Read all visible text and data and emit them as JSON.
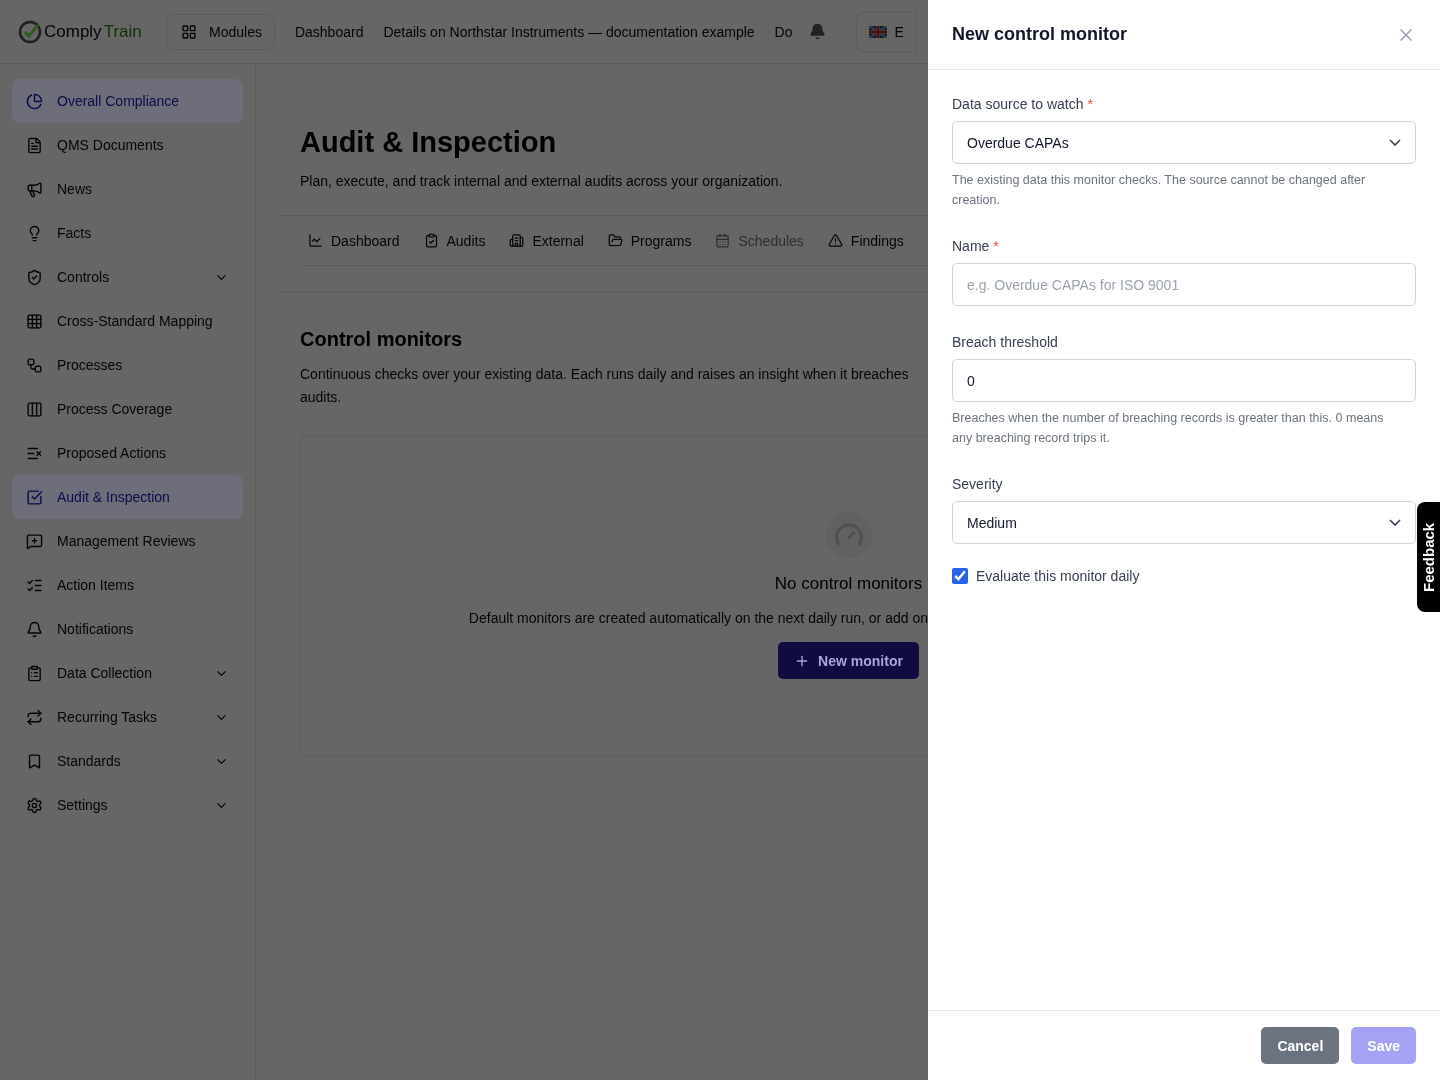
{
  "topbar": {
    "logo": {
      "part1": "Comply",
      "part2": "Train"
    },
    "modules_button": "Modules",
    "nav": [
      "Dashboard",
      "Details on Northstar Instruments — documentation example",
      "Do"
    ],
    "language": "E"
  },
  "sidebar": {
    "items": [
      {
        "label": "Overall Compliance",
        "selected": true,
        "expandable": false
      },
      {
        "label": "QMS Documents",
        "selected": false,
        "expandable": false
      },
      {
        "label": "News",
        "selected": false,
        "expandable": false
      },
      {
        "label": "Facts",
        "selected": false,
        "expandable": false
      },
      {
        "label": "Controls",
        "selected": false,
        "expandable": true
      },
      {
        "label": "Cross-Standard Mapping",
        "selected": false,
        "expandable": false
      },
      {
        "label": "Processes",
        "selected": false,
        "expandable": false
      },
      {
        "label": "Process Coverage",
        "selected": false,
        "expandable": false
      },
      {
        "label": "Proposed Actions",
        "selected": false,
        "expandable": false
      },
      {
        "label": "Audit & Inspection",
        "selected": true,
        "expandable": false
      },
      {
        "label": "Management Reviews",
        "selected": false,
        "expandable": false
      },
      {
        "label": "Action Items",
        "selected": false,
        "expandable": false
      },
      {
        "label": "Notifications",
        "selected": false,
        "expandable": false
      },
      {
        "label": "Data Collection",
        "selected": false,
        "expandable": true
      },
      {
        "label": "Recurring Tasks",
        "selected": false,
        "expandable": true
      },
      {
        "label": "Standards",
        "selected": false,
        "expandable": true
      },
      {
        "label": "Settings",
        "selected": false,
        "expandable": true
      }
    ]
  },
  "page": {
    "title": "Audit & Inspection",
    "subtitle": "Plan, execute, and track internal and external audits across your organization.",
    "tabs": [
      {
        "label": "Dashboard",
        "disabled": false
      },
      {
        "label": "Audits",
        "disabled": false
      },
      {
        "label": "External",
        "disabled": false
      },
      {
        "label": "Programs",
        "disabled": false
      },
      {
        "label": "Schedules",
        "disabled": true
      },
      {
        "label": "Findings",
        "disabled": false
      }
    ],
    "section": {
      "title": "Control monitors",
      "description_line1": "Continuous checks over your existing data. Each runs daily and raises an insight when it breaches",
      "description_line2": "audits.",
      "empty_state": {
        "title": "No control monitors",
        "text": "Default monitors are created automatically on the next daily run, or add on",
        "button": "New monitor"
      }
    }
  },
  "drawer": {
    "title": "New control monitor",
    "fields": [
      {
        "kind": "select",
        "label": "Data source to watch",
        "required": true,
        "value": "Overdue CAPAs",
        "help": "The existing data this monitor checks. The source cannot be changed after creation."
      },
      {
        "kind": "text",
        "label": "Name",
        "required": true,
        "placeholder": "e.g. Overdue CAPAs for ISO 9001"
      },
      {
        "kind": "text",
        "label": "Breach threshold",
        "required": false,
        "value": "0",
        "help": "Breaches when the number of breaching records is greater than this. 0 means any breaching record trips it."
      },
      {
        "kind": "select",
        "label": "Severity",
        "required": false,
        "value": "Medium"
      }
    ],
    "checkbox": {
      "label": "Evaluate this monitor daily",
      "checked": true
    },
    "required_mark": "*",
    "buttons": [
      {
        "label": "Cancel",
        "kind": "secondary"
      },
      {
        "label": "Save",
        "kind": "primary",
        "disabled": true
      }
    ]
  },
  "feedback_tab": "Feedback"
}
